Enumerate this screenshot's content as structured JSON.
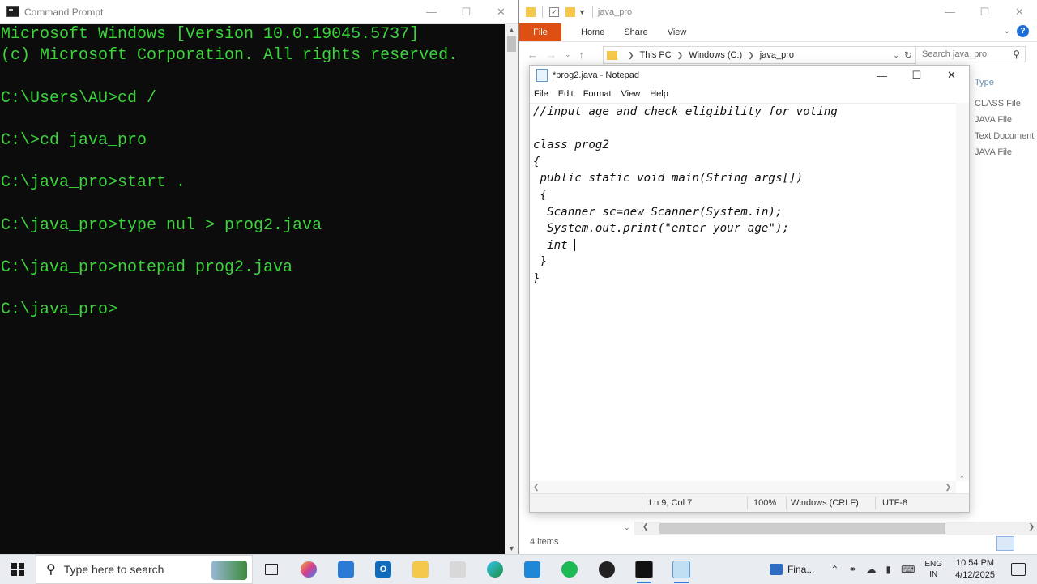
{
  "cmd": {
    "title": "Command Prompt",
    "lines": [
      "Microsoft Windows [Version 10.0.19045.5737]",
      "(c) Microsoft Corporation. All rights reserved.",
      "",
      "C:\\Users\\AU>cd /",
      "",
      "C:\\>cd java_pro",
      "",
      "C:\\java_pro>start .",
      "",
      "C:\\java_pro>type nul > prog2.java",
      "",
      "C:\\java_pro>notepad prog2.java",
      "",
      "C:\\java_pro>"
    ]
  },
  "explorer": {
    "title": "java_pro",
    "tabs": [
      "File",
      "Home",
      "Share",
      "View"
    ],
    "breadcrumb": [
      "This PC",
      "Windows (C:)",
      "java_pro"
    ],
    "search_placeholder": "Search java_pro",
    "column_header": "Type",
    "types": [
      "CLASS File",
      "JAVA File",
      "Text Document",
      "JAVA File"
    ],
    "status": "4 items",
    "accent": "#dd4f12"
  },
  "notepad": {
    "title": "*prog2.java - Notepad",
    "menu": [
      "File",
      "Edit",
      "Format",
      "View",
      "Help"
    ],
    "code": [
      "//input age and check eligibility for voting",
      "",
      "class prog2",
      "{",
      " public static void main(String args[])",
      " {",
      "  Scanner sc=new Scanner(System.in);",
      "  System.out.print(\"enter your age\");",
      "  int ",
      " }",
      "}"
    ],
    "status": {
      "position": "Ln 9, Col 7",
      "zoom": "100%",
      "line_ending": "Windows (CRLF)",
      "encoding": "UTF-8"
    }
  },
  "taskbar": {
    "search_placeholder": "Type here to search",
    "widget_label": "Fina...",
    "language": [
      "ENG",
      "IN"
    ],
    "time": "10:54 PM",
    "date": "4/12/2025",
    "apps": [
      "task-view",
      "copilot",
      "store",
      "outlook",
      "file-explorer",
      "paint",
      "edge",
      "vscode",
      "spotify",
      "obs",
      "terminal",
      "notepad"
    ]
  }
}
